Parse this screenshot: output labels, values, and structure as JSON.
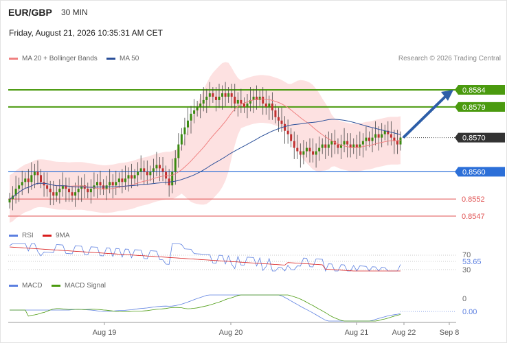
{
  "header": {
    "pair": "EUR/GBP",
    "timeframe": "30 MIN",
    "datetime": "Friday, August 21, 2026 10:35:31 AM CET"
  },
  "legend": {
    "ma20_label": "MA 20 + Bollinger Bands",
    "ma50_label": "MA 50",
    "rsi_label": "RSI",
    "rsi_ma_label": "9MA",
    "macd_label": "MACD",
    "macd_signal_label": "MACD Signal"
  },
  "credit": "Research © 2026 Trading Central",
  "colors": {
    "green": "#4a9a0e",
    "blue": "#2c6fd8",
    "red": "#e05252",
    "dark": "#333333",
    "arrow": "#2d5ea8",
    "ma50": "#2a4f99",
    "ma20": "#f08080",
    "band": "#fcd9d9",
    "rsi": "#5b7fe0",
    "rsi_ma": "#d91c1c",
    "macd": "#5b7fe0",
    "signal": "#4a9a0e"
  },
  "chart_data": {
    "type": "candlestick",
    "symbol": "EUR/GBP",
    "timeframe": "30 MIN",
    "x_axis": {
      "labels": [
        "Aug 19",
        "Aug 20",
        "Aug 21",
        "Aug 22",
        "Sep 8"
      ]
    },
    "y_range": [
      0.85445,
      0.85895
    ],
    "levels": [
      {
        "value": 0.8584,
        "label": "0.8584",
        "kind": "resistance",
        "color": "green"
      },
      {
        "value": 0.8579,
        "label": "0.8579",
        "kind": "resistance",
        "color": "green"
      },
      {
        "value": 0.857,
        "label": "0.8570",
        "kind": "current",
        "color": "dark"
      },
      {
        "value": 0.856,
        "label": "0.8560",
        "kind": "pivot",
        "color": "blue"
      },
      {
        "value": 0.8552,
        "label": "0.8552",
        "kind": "support",
        "color": "red"
      },
      {
        "value": 0.8547,
        "label": "0.8547",
        "kind": "support",
        "color": "red"
      }
    ],
    "candles_close": [
      0.8552,
      0.8553,
      0.8555,
      0.8556,
      0.8557,
      0.8558,
      0.8557,
      0.8559,
      0.856,
      0.8559,
      0.8557,
      0.8556,
      0.8555,
      0.8554,
      0.8553,
      0.8554,
      0.8555,
      0.8556,
      0.8555,
      0.8554,
      0.8553,
      0.8554,
      0.8555,
      0.8556,
      0.8555,
      0.8554,
      0.8555,
      0.8556,
      0.8557,
      0.8556,
      0.8555,
      0.8556,
      0.8557,
      0.8556,
      0.8557,
      0.8558,
      0.8557,
      0.8558,
      0.8559,
      0.8558,
      0.8559,
      0.856,
      0.8561,
      0.856,
      0.8559,
      0.856,
      0.8561,
      0.8562,
      0.8561,
      0.856,
      0.8558,
      0.8556,
      0.856,
      0.8564,
      0.8568,
      0.8571,
      0.8573,
      0.8575,
      0.8577,
      0.8578,
      0.8579,
      0.858,
      0.8581,
      0.8582,
      0.8583,
      0.8582,
      0.8581,
      0.8582,
      0.8583,
      0.8582,
      0.8583,
      0.8582,
      0.858,
      0.8581,
      0.858,
      0.8579,
      0.858,
      0.8581,
      0.8582,
      0.8581,
      0.8582,
      0.858,
      0.8579,
      0.858,
      0.8578,
      0.8576,
      0.8575,
      0.8574,
      0.8572,
      0.8571,
      0.8569,
      0.8567,
      0.8566,
      0.8565,
      0.8566,
      0.8567,
      0.8566,
      0.8565,
      0.8566,
      0.8567,
      0.8568,
      0.8567,
      0.8568,
      0.8569,
      0.8568,
      0.8567,
      0.8568,
      0.8569,
      0.8568,
      0.8567,
      0.8568,
      0.8567,
      0.8568,
      0.8569,
      0.857,
      0.8569,
      0.857,
      0.8571,
      0.857,
      0.8571,
      0.8572,
      0.8571,
      0.857,
      0.8569,
      0.8568,
      0.857
    ],
    "forecast": {
      "from": 0.857,
      "to": 0.8584
    },
    "rsi": {
      "value": "53.65",
      "levels": [
        "70",
        "30"
      ]
    },
    "macd": {
      "value": "0.00",
      "levels": [
        "0"
      ]
    }
  }
}
